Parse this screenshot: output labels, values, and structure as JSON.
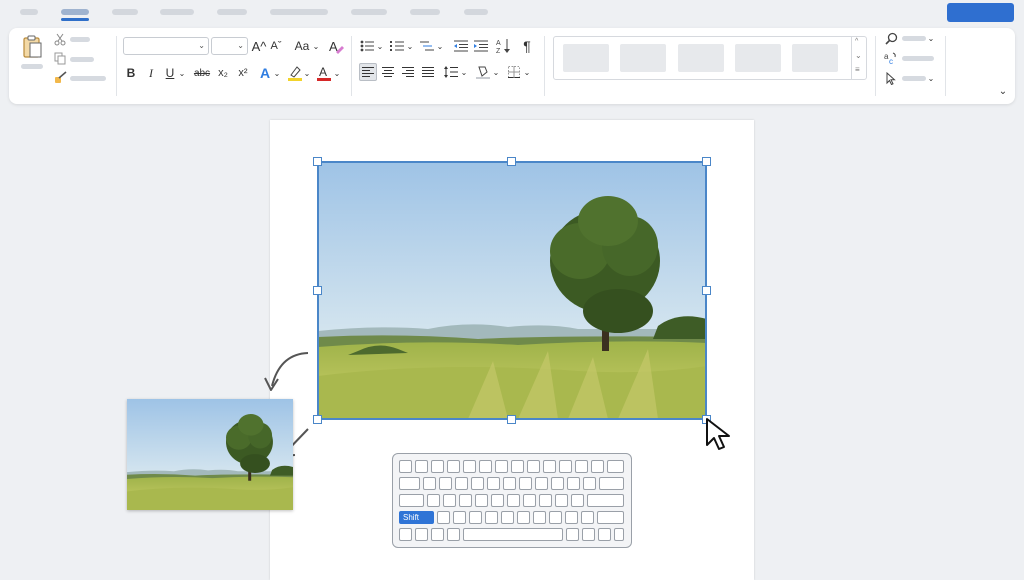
{
  "keyboard": {
    "shift_label": "Shift"
  },
  "colors": {
    "accent": "#2f6fd0",
    "selection": "#4a86c8",
    "shift_key": "#2f74d6",
    "highlight": "#f2d32b",
    "font_color": "#d62828"
  },
  "icons": {
    "paste": "clipboard-icon",
    "cut": "scissors-icon",
    "copy": "copy-icon",
    "format_painter": "paintbrush-icon",
    "find": "magnifier-icon",
    "replace": "replace-icon",
    "select": "cursor-icon",
    "collapse": "chevron-down-icon"
  },
  "ribbon": {
    "bold": "B",
    "italic": "I",
    "underline": "U",
    "strike": "abc",
    "subscript": "x₂",
    "superscript": "x²",
    "grow_font": "A^",
    "shrink_font": "Aˇ",
    "change_case": "Aa",
    "text_effects": "A",
    "highlight": "ab",
    "font_color": "A",
    "pilcrow": "¶"
  }
}
